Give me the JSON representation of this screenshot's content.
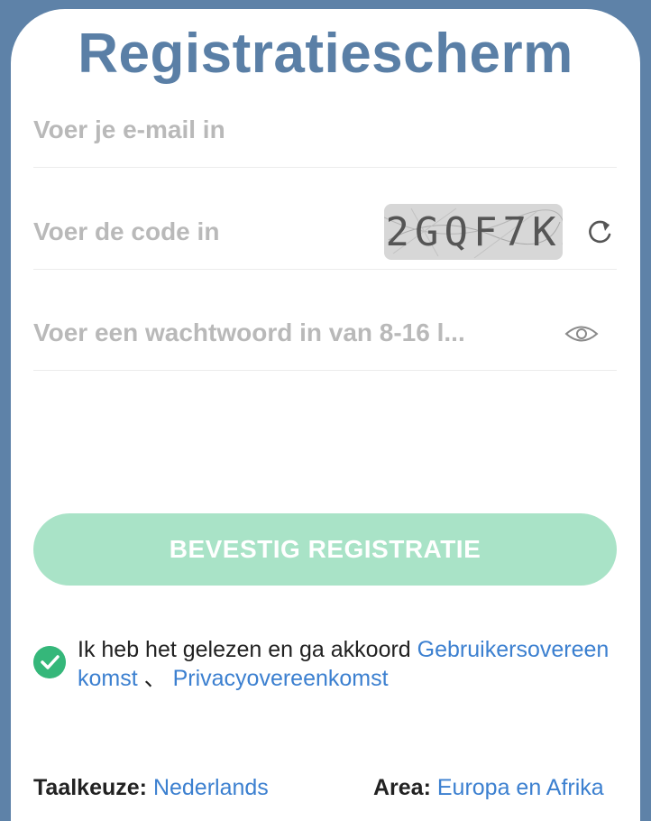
{
  "title": "Registratiescherm",
  "email": {
    "placeholder": "Voer je e-mail in"
  },
  "code": {
    "placeholder": "Voer de code in",
    "captcha": "2GQF7K"
  },
  "password": {
    "placeholder": "Voer een wachtwoord in van 8-16 l..."
  },
  "confirm_button": "BEVESTIG REGISTRATIE",
  "agreement": {
    "text": "Ik heb het gelezen en ga akkoord ",
    "link1": "Gebruikersovereenkomst",
    "separator": " 、 ",
    "link2": "Privacyovereenkomst"
  },
  "footer": {
    "language_label": "Taalkeuze:",
    "language_value": "Nederlands",
    "area_label": "Area:",
    "area_value": "Europa en Afrika"
  },
  "colors": {
    "background": "#5e82a8",
    "title": "#5a7fa6",
    "button": "#a9e3c7",
    "check": "#35b77a",
    "link": "#3c80d0"
  },
  "icons": [
    "refresh-icon",
    "eye-icon",
    "check-icon"
  ]
}
